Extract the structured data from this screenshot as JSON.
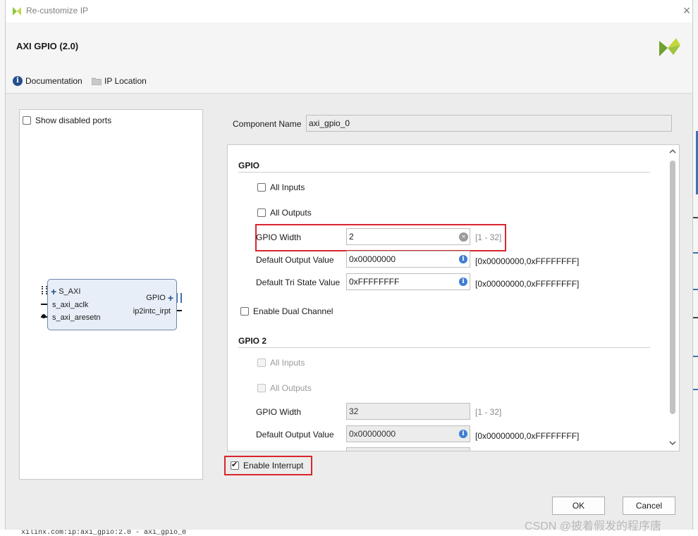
{
  "window": {
    "title": "Re-customize IP",
    "close_glyph": "×"
  },
  "header": {
    "ip_name": "AXI GPIO (2.0)",
    "links": {
      "documentation": "Documentation",
      "ip_location": "IP Location"
    }
  },
  "left_panel": {
    "show_disabled_ports": {
      "label": "Show disabled ports",
      "checked": false
    },
    "block": {
      "left_ports": [
        "S_AXI",
        "s_axi_aclk",
        "s_axi_aresetn"
      ],
      "right_ports": [
        "GPIO",
        "ip2intc_irpt"
      ],
      "plus_glyph": "+"
    }
  },
  "component": {
    "label": "Component Name",
    "value": "axi_gpio_0"
  },
  "gpio": {
    "title": "GPIO",
    "all_inputs": {
      "label": "All Inputs",
      "checked": false
    },
    "all_outputs": {
      "label": "All Outputs",
      "checked": false
    },
    "width": {
      "label": "GPIO Width",
      "value": "2",
      "range": "[1 - 32]"
    },
    "default_output": {
      "label": "Default Output Value",
      "value": "0x00000000",
      "range": "[0x00000000,0xFFFFFFFF]"
    },
    "default_tri": {
      "label": "Default Tri State Value",
      "value": "0xFFFFFFFF",
      "range": "[0x00000000,0xFFFFFFFF]"
    }
  },
  "dual_channel": {
    "label": "Enable Dual Channel",
    "checked": false
  },
  "gpio2": {
    "title": "GPIO 2",
    "all_inputs": {
      "label": "All Inputs",
      "checked": false
    },
    "all_outputs": {
      "label": "All Outputs",
      "checked": false
    },
    "width": {
      "label": "GPIO Width",
      "value": "32",
      "range": "[1 - 32]"
    },
    "default_output": {
      "label": "Default Output Value",
      "value": "0x00000000",
      "range": "[0x00000000,0xFFFFFFFF]"
    }
  },
  "interrupt": {
    "label": "Enable Interrupt",
    "checked": true
  },
  "buttons": {
    "ok": "OK",
    "cancel": "Cancel"
  },
  "watermark": "CSDN @披着假发的程序唐",
  "background": {
    "bottom_text": "xilinx.com:ip:axi_gpio:2.0 - axi_gpio_0"
  },
  "colors": {
    "highlight_red": "#d9262c",
    "info_blue": "#3f7ed3",
    "block_fill": "#e7eef7",
    "block_border": "#6f88a8",
    "xilinx_green": "#8dc63f"
  }
}
